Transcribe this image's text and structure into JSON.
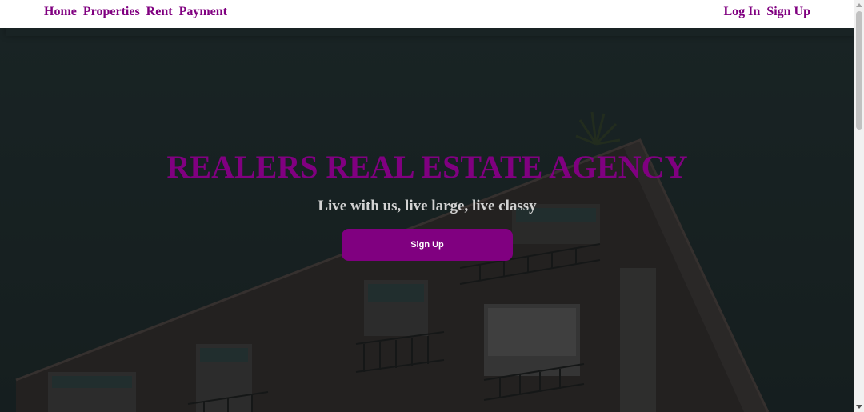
{
  "nav": {
    "left": [
      "Home",
      "Properties",
      "Rent",
      "Payment"
    ],
    "right": [
      "Log In",
      "Sign Up"
    ]
  },
  "hero": {
    "title": "REALERS REAL ESTATE AGENCY",
    "tagline": "Live with us, live large, live classy",
    "button_label": "Sign Up"
  },
  "colors": {
    "brand": "#800080",
    "hero_overlay": "#1e2a2b",
    "tagline": "#d2d2d2"
  }
}
